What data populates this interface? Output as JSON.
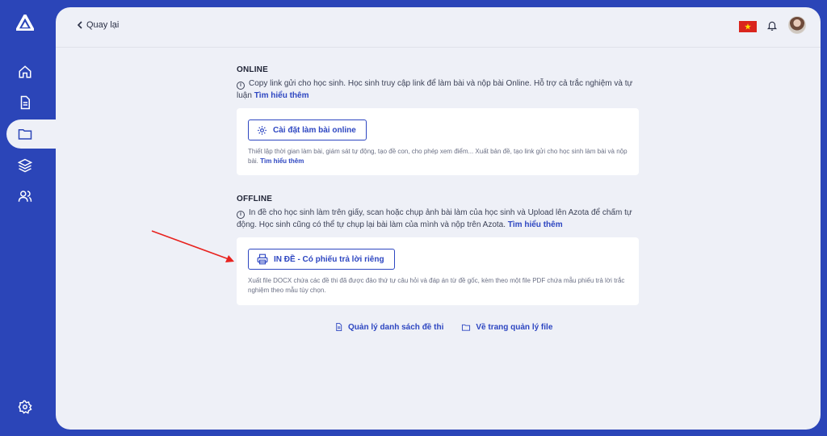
{
  "nav": {
    "back_label": "Quay lại"
  },
  "online": {
    "title": "ONLINE",
    "description": "Copy link gửi cho học sinh. Học sinh truy cập link để làm bài và nộp bài Online. Hỗ trợ cả trắc nghiệm và tự luận",
    "learn_more": "Tìm hiểu thêm",
    "button_label": "Cài đặt làm bài online",
    "card_description": "Thiết lập thời gian làm bài, giám sát tự động, tạo đề con, cho phép xem điểm... Xuất bản đề, tạo link gửi cho học sinh làm bài và nộp bài.",
    "card_learn_more": "Tìm hiểu thêm"
  },
  "offline": {
    "title": "OFFLINE",
    "description": "In đề cho học sinh làm trên giấy, scan hoặc chụp ảnh bài làm của học sinh và Upload lên Azota để chấm tự động. Học sinh cũng có thể tự chụp lại bài làm của mình và nộp trên Azota.",
    "learn_more": "Tìm hiểu thêm",
    "button_label": "IN ĐỀ - Có phiếu trả lời riêng",
    "card_description": "Xuất file DOCX chứa các đề thi đã được đảo thứ tự câu hỏi và đáp án từ đề gốc, kèm theo một file PDF chứa mẫu phiếu trả lời trắc nghiệm theo mẫu tùy chọn."
  },
  "footer_links": {
    "exam_list": "Quản lý danh sách đề thi",
    "file_manager": "Về trang quản lý file"
  },
  "colors": {
    "sidebar": "#2b45b8",
    "accent": "#2d46c1",
    "background": "#eef0f7",
    "arrow": "#e8231f"
  },
  "icons": [
    "logo-icon",
    "home-icon",
    "document-icon",
    "folder-icon",
    "layers-icon",
    "users-icon",
    "settings-icon",
    "chevron-left-icon",
    "vietnam-flag-icon",
    "bell-icon",
    "gear-icon",
    "printer-icon",
    "file-list-icon",
    "folder-icon",
    "info-icon"
  ]
}
